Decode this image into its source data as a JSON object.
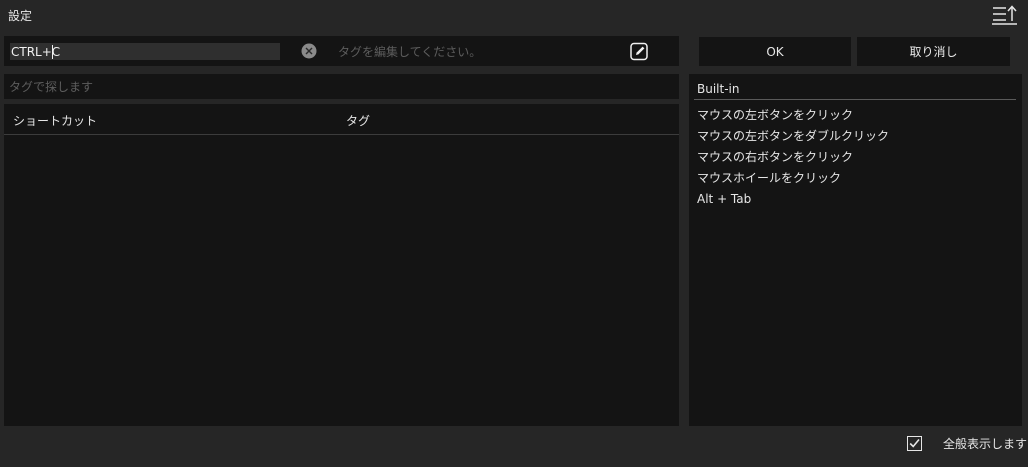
{
  "window": {
    "title": "設定"
  },
  "toolbar": {
    "menu_icon": "menu-sort-up-icon"
  },
  "shortcut": {
    "value": "CTRL+C",
    "tag_placeholder": "タグを編集してください。",
    "clear_icon": "clear-circle-icon",
    "edit_icon": "edit-pencil-icon"
  },
  "buttons": {
    "ok": "OK",
    "cancel": "取り消し"
  },
  "search": {
    "placeholder": "タグで探します"
  },
  "table": {
    "columns": [
      "ショートカット",
      "タグ"
    ],
    "rows": []
  },
  "builtin": {
    "header": "Built-in",
    "items": [
      "マウスの左ボタンをクリック",
      "マウスの左ボタンをダブルクリック",
      "マウスの右ボタンをクリック",
      "マウスホイールをクリック",
      "Alt + Tab"
    ]
  },
  "show_all": {
    "label": "全般表示します",
    "checked": true
  },
  "colors": {
    "background": "#262626",
    "panel": "#141414",
    "text": "#e6e6e6",
    "placeholder": "#5d5d5d"
  }
}
